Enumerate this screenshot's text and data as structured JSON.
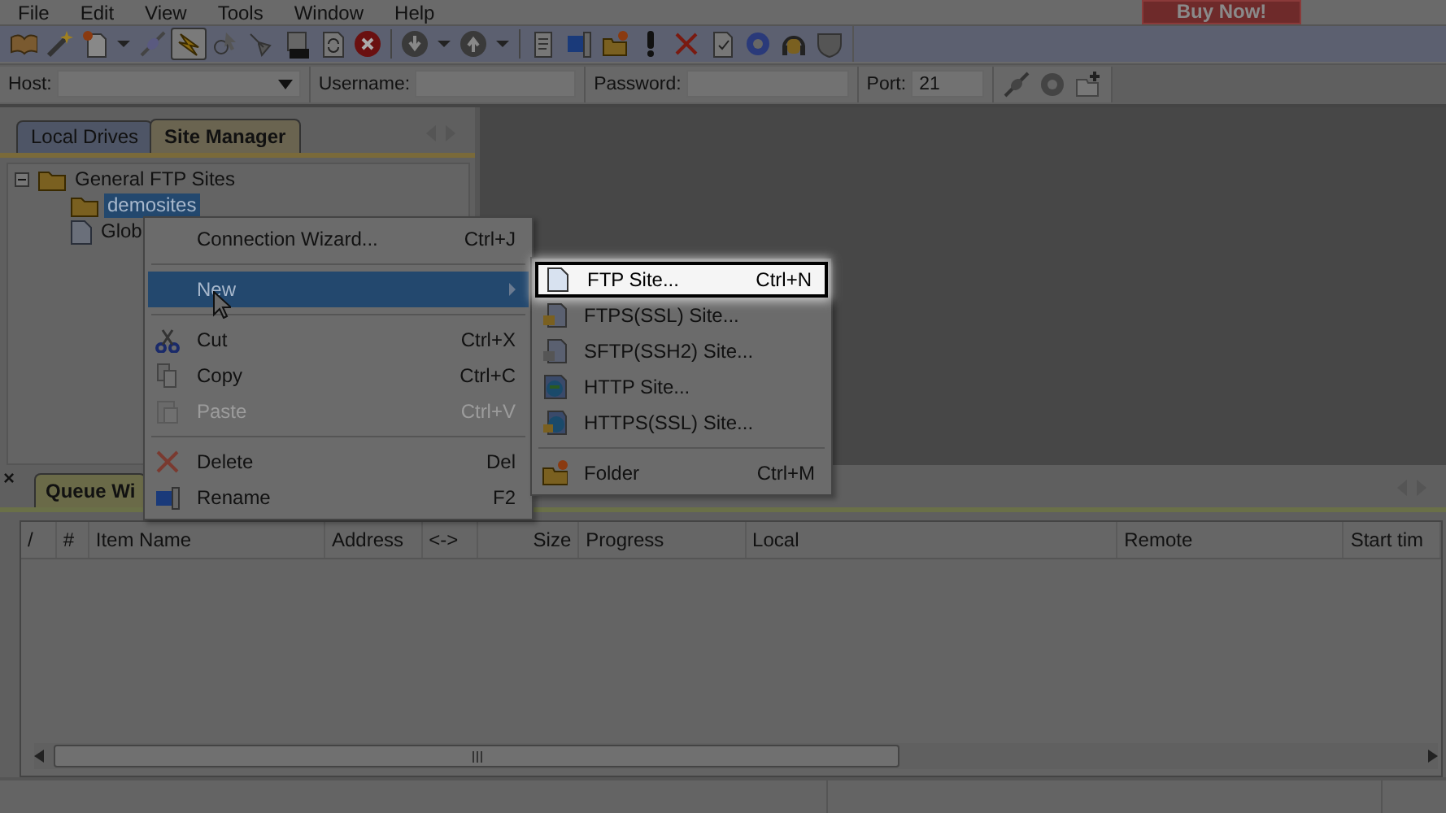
{
  "menu_bar": [
    {
      "label": "File"
    },
    {
      "label": "Edit"
    },
    {
      "label": "View"
    },
    {
      "label": "Tools"
    },
    {
      "label": "Window"
    },
    {
      "label": "Help"
    }
  ],
  "buy_button": {
    "label": "Buy Now!"
  },
  "toolbar": [
    {
      "pressed": false
    },
    {
      "pressed": false
    },
    {
      "pressed": false
    },
    {
      "pressed": false
    },
    {
      "pressed": false
    },
    {
      "pressed": true
    },
    {
      "pressed": false
    },
    {
      "pressed": false
    },
    {
      "pressed": false
    },
    {
      "pressed": false
    },
    {
      "pressed": false
    },
    {
      "pressed": false
    },
    {
      "pressed": false
    },
    {
      "pressed": false
    },
    {
      "pressed": false
    },
    {
      "pressed": false
    },
    {
      "pressed": false
    },
    {
      "pressed": false
    },
    {
      "pressed": false
    },
    {
      "pressed": false
    },
    {
      "pressed": false
    },
    {
      "pressed": false
    },
    {
      "pressed": false
    },
    {
      "pressed": false
    }
  ],
  "connection_bar": {
    "host": {
      "label": "Host:"
    },
    "username": {
      "label": "Username:"
    },
    "password": {
      "label": "Password:"
    },
    "port": {
      "label": "Port:",
      "value": "21"
    }
  },
  "left_panel": {
    "tabs": [
      {
        "label": "Local Drives",
        "selected": false
      },
      {
        "label": "Site Manager",
        "selected": true
      }
    ],
    "tree": [
      {
        "label": "General FTP Sites",
        "kind": "folder",
        "expanded": true,
        "selected": false,
        "children": [
          {
            "label": "demosites",
            "kind": "folder",
            "selected": true
          },
          {
            "label": "Glob",
            "kind": "file",
            "selected": false
          }
        ]
      }
    ]
  },
  "context_menu": {
    "items": [
      {
        "kind": "item",
        "label": "Connection Wizard...",
        "shortcut": "Ctrl+J",
        "selected": false,
        "disabled": false
      },
      {
        "kind": "separator"
      },
      {
        "kind": "submenu",
        "label": "New",
        "selected": true,
        "disabled": false
      },
      {
        "kind": "separator"
      },
      {
        "kind": "item",
        "label": "Cut",
        "shortcut": "Ctrl+X",
        "selected": false,
        "disabled": false
      },
      {
        "kind": "item",
        "label": "Copy",
        "shortcut": "Ctrl+C",
        "selected": false,
        "disabled": false
      },
      {
        "kind": "item",
        "label": "Paste",
        "shortcut": "Ctrl+V",
        "selected": false,
        "disabled": true
      },
      {
        "kind": "separator"
      },
      {
        "kind": "item",
        "label": "Delete",
        "shortcut": "Del",
        "selected": false,
        "disabled": false
      },
      {
        "kind": "item",
        "label": "Rename",
        "shortcut": "F2",
        "selected": false,
        "disabled": false
      }
    ]
  },
  "submenu": {
    "items": [
      {
        "kind": "item",
        "label": "FTP Site...",
        "shortcut": "Ctrl+N",
        "highlighted": true
      },
      {
        "kind": "item",
        "label": "FTPS(SSL) Site...",
        "highlighted": false
      },
      {
        "kind": "item",
        "label": "SFTP(SSH2) Site...",
        "highlighted": false
      },
      {
        "kind": "item",
        "label": "HTTP Site...",
        "highlighted": false
      },
      {
        "kind": "item",
        "label": "HTTPS(SSL) Site...",
        "highlighted": false
      },
      {
        "kind": "separator"
      },
      {
        "kind": "item",
        "label": "Folder",
        "shortcut": "Ctrl+M",
        "highlighted": false
      }
    ]
  },
  "queue_panel": {
    "close_glyph": "×",
    "tabs": [
      {
        "label": "Queue Wi",
        "selected": true
      }
    ],
    "columns": [
      "/",
      "#",
      "Item Name",
      "Address",
      "<->",
      "Size",
      "Progress",
      "Local",
      "Remote",
      "Start tim"
    ]
  }
}
